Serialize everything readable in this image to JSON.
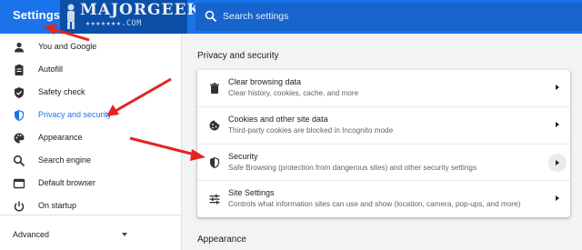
{
  "app": {
    "title": "Settings"
  },
  "watermark": {
    "text": "MAJORGEEKS",
    "subtext": "★★★★★★★.COM"
  },
  "search": {
    "placeholder": "Search settings"
  },
  "sidebar": {
    "items": [
      {
        "label": "You and Google",
        "icon": "person-icon"
      },
      {
        "label": "Autofill",
        "icon": "clipboard-icon"
      },
      {
        "label": "Safety check",
        "icon": "shield-check-icon"
      },
      {
        "label": "Privacy and security",
        "icon": "shield-icon",
        "active": true
      },
      {
        "label": "Appearance",
        "icon": "palette-icon"
      },
      {
        "label": "Search engine",
        "icon": "search-icon"
      },
      {
        "label": "Default browser",
        "icon": "browser-icon"
      },
      {
        "label": "On startup",
        "icon": "power-icon"
      }
    ],
    "advanced_label": "Advanced"
  },
  "main": {
    "section_title": "Privacy and security",
    "rows": [
      {
        "title": "Clear browsing data",
        "subtitle": "Clear history, cookies, cache, and more",
        "icon": "trash-icon"
      },
      {
        "title": "Cookies and other site data",
        "subtitle": "Third-party cookies are blocked in Incognito mode",
        "icon": "cookie-icon"
      },
      {
        "title": "Security",
        "subtitle": "Safe Browsing (protection from dangerous sites) and other security settings",
        "icon": "shield-icon"
      },
      {
        "title": "Site Settings",
        "subtitle": "Controls what information sites can use and show (location, camera, pop-ups, and more)",
        "icon": "sliders-icon"
      }
    ],
    "next_section_title": "Appearance"
  },
  "colors": {
    "accent": "#1a73e8",
    "annotation": "#e52421"
  }
}
